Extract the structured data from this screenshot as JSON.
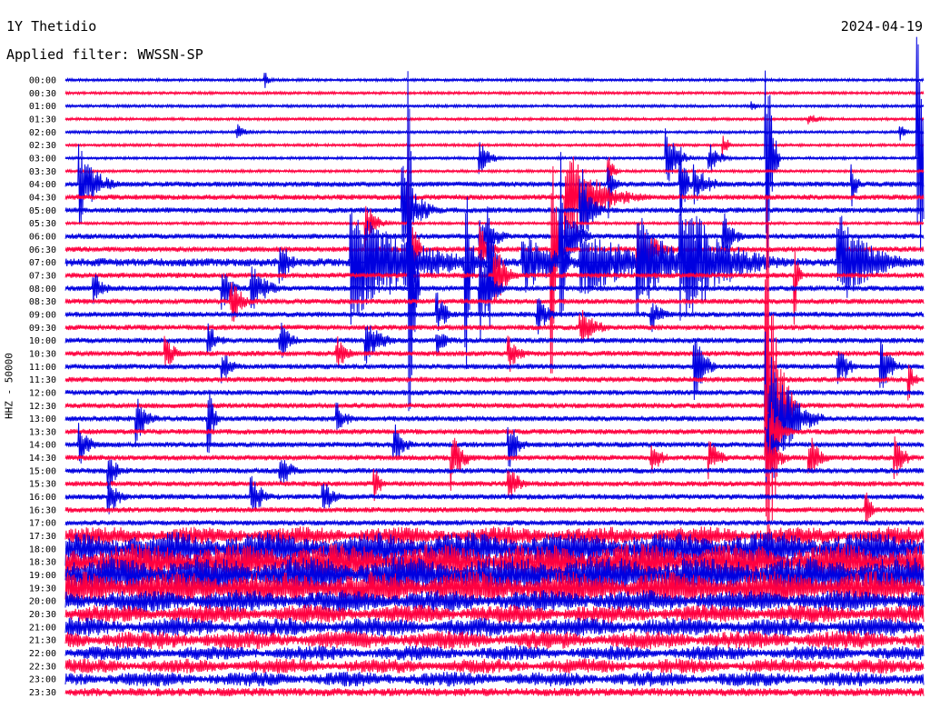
{
  "header": {
    "title": "1Y Thetidio",
    "date": "2024-04-19",
    "filter": "Applied filter: WWSSN-SP"
  },
  "chart_data": {
    "type": "helicorder",
    "title": "1Y Thetidio",
    "date": "2024-04-19",
    "filter": "WWSSN-SP",
    "ylabel": "HHZ - 50000",
    "trace_colors": [
      "#0000e0",
      "#ff0040"
    ],
    "row_labels": [
      "00:00",
      "00:30",
      "01:00",
      "01:30",
      "02:00",
      "02:30",
      "03:00",
      "03:30",
      "04:00",
      "04:30",
      "05:00",
      "05:30",
      "06:00",
      "06:30",
      "07:00",
      "07:30",
      "08:00",
      "08:30",
      "09:00",
      "09:30",
      "10:00",
      "10:30",
      "11:00",
      "11:30",
      "12:00",
      "12:30",
      "13:00",
      "13:30",
      "14:00",
      "14:30",
      "15:00",
      "15:30",
      "16:00",
      "16:30",
      "17:00",
      "17:30",
      "18:00",
      "18:30",
      "19:00",
      "19:30",
      "20:00",
      "20:30",
      "21:00",
      "21:30",
      "22:00",
      "22:30",
      "23:00",
      "23:30"
    ],
    "noise_level": [
      1,
      1,
      1,
      1,
      1,
      1,
      1,
      1,
      2,
      2,
      2,
      1,
      2,
      2,
      3,
      2,
      2,
      2,
      2,
      2,
      2,
      2,
      2,
      2,
      2,
      2,
      2,
      2,
      2,
      2,
      2,
      2,
      2,
      2,
      2,
      5,
      9,
      10,
      10,
      9,
      6,
      5,
      5,
      5,
      4,
      4,
      4,
      3
    ],
    "events": [
      {
        "row": 8,
        "minute": 0.5,
        "amplitude": 50,
        "duration": 1.5
      },
      {
        "row": 6,
        "minute": 22.5,
        "amplitude": 20,
        "duration": 1
      },
      {
        "row": 8,
        "minute": 22,
        "amplitude": 25,
        "duration": 1.5
      },
      {
        "row": 14,
        "minute": 10,
        "amplitude": 70,
        "duration": 6
      },
      {
        "row": 14,
        "minute": 16,
        "amplitude": 40,
        "duration": 3
      },
      {
        "row": 13,
        "minute": 12,
        "amplitude": 150,
        "duration": 0.5
      },
      {
        "row": 16,
        "minute": 12,
        "amplitude": 280,
        "duration": 0.4
      },
      {
        "row": 14,
        "minute": 18,
        "amplitude": 40,
        "duration": 6
      },
      {
        "row": 15,
        "minute": 25.5,
        "amplitude": 60,
        "duration": 0.3
      },
      {
        "row": 13,
        "minute": 17,
        "amplitude": 160,
        "duration": 0.4
      },
      {
        "row": 14,
        "minute": 21.5,
        "amplitude": 80,
        "duration": 4
      },
      {
        "row": 8,
        "minute": 19,
        "amplitude": 40,
        "duration": 0.5
      },
      {
        "row": 13,
        "minute": 20,
        "amplitude": 30,
        "duration": 2
      },
      {
        "row": 14,
        "minute": 27,
        "amplitude": 60,
        "duration": 3
      },
      {
        "row": 10,
        "minute": 18,
        "amplitude": 60,
        "duration": 1
      },
      {
        "row": 12,
        "minute": 17.5,
        "amplitude": 60,
        "duration": 1
      },
      {
        "row": 14,
        "minute": 17.3,
        "amplitude": 150,
        "duration": 0.3
      },
      {
        "row": 6,
        "minute": 21,
        "amplitude": 40,
        "duration": 1
      },
      {
        "row": 8,
        "minute": 21.5,
        "amplitude": 60,
        "duration": 0.5
      },
      {
        "row": 9,
        "minute": 17.5,
        "amplitude": 60,
        "duration": 3
      },
      {
        "row": 12,
        "minute": 23,
        "amplitude": 30,
        "duration": 1
      },
      {
        "row": 12,
        "minute": 14.5,
        "amplitude": 30,
        "duration": 1.5
      },
      {
        "row": 13,
        "minute": 14.5,
        "amplitude": 30,
        "duration": 1
      },
      {
        "row": 14,
        "minute": 14,
        "amplitude": 140,
        "duration": 0.4
      },
      {
        "row": 14,
        "minute": 14.8,
        "amplitude": 120,
        "duration": 0.4
      },
      {
        "row": 16,
        "minute": 14.5,
        "amplitude": 60,
        "duration": 1
      },
      {
        "row": 14,
        "minute": 20,
        "amplitude": 60,
        "duration": 3
      },
      {
        "row": 10,
        "minute": 11.8,
        "amplitude": 50,
        "duration": 1.5
      },
      {
        "row": 11,
        "minute": 10.5,
        "amplitude": 30,
        "duration": 1
      },
      {
        "row": 14,
        "minute": 7.5,
        "amplitude": 30,
        "duration": 1
      },
      {
        "row": 15,
        "minute": 15,
        "amplitude": 45,
        "duration": 1
      },
      {
        "row": 16,
        "minute": 1,
        "amplitude": 20,
        "duration": 1
      },
      {
        "row": 16,
        "minute": 5.5,
        "amplitude": 25,
        "duration": 1
      },
      {
        "row": 6,
        "minute": 14.5,
        "amplitude": 20,
        "duration": 1
      },
      {
        "row": 6,
        "minute": 24.5,
        "amplitude": 160,
        "duration": 0.5
      },
      {
        "row": 6,
        "minute": 29.8,
        "amplitude": 160,
        "duration": 0.8
      },
      {
        "row": 25,
        "minute": 24.5,
        "amplitude": 260,
        "duration": 1
      },
      {
        "row": 26,
        "minute": 24.5,
        "amplitude": 100,
        "duration": 2
      },
      {
        "row": 27,
        "minute": 24.5,
        "amplitude": 60,
        "duration": 1
      },
      {
        "row": 28,
        "minute": 24.5,
        "amplitude": 60,
        "duration": 0.5
      },
      {
        "row": 29,
        "minute": 24.5,
        "amplitude": 40,
        "duration": 1
      },
      {
        "row": 22,
        "minute": 22,
        "amplitude": 40,
        "duration": 1
      },
      {
        "row": 22,
        "minute": 27,
        "amplitude": 30,
        "duration": 1
      },
      {
        "row": 22,
        "minute": 28.5,
        "amplitude": 35,
        "duration": 1
      },
      {
        "row": 23,
        "minute": 29.5,
        "amplitude": 25,
        "duration": 0.5
      },
      {
        "row": 26,
        "minute": 5,
        "amplitude": 45,
        "duration": 0.5
      },
      {
        "row": 29,
        "minute": 29,
        "amplitude": 25,
        "duration": 1
      },
      {
        "row": 29,
        "minute": 26,
        "amplitude": 30,
        "duration": 1
      },
      {
        "row": 29,
        "minute": 22.5,
        "amplitude": 25,
        "duration": 1
      },
      {
        "row": 29,
        "minute": 20.5,
        "amplitude": 20,
        "duration": 1
      },
      {
        "row": 29,
        "minute": 13.5,
        "amplitude": 40,
        "duration": 1
      },
      {
        "row": 28,
        "minute": 15.5,
        "amplitude": 30,
        "duration": 1
      },
      {
        "row": 28,
        "minute": 0.5,
        "amplitude": 25,
        "duration": 1
      },
      {
        "row": 28,
        "minute": 11.5,
        "amplitude": 25,
        "duration": 1
      },
      {
        "row": 32,
        "minute": 1.5,
        "amplitude": 25,
        "duration": 1
      },
      {
        "row": 32,
        "minute": 6.5,
        "amplitude": 30,
        "duration": 1
      },
      {
        "row": 32,
        "minute": 9,
        "amplitude": 25,
        "duration": 1
      },
      {
        "row": 33,
        "minute": 28,
        "amplitude": 25,
        "duration": 0.5
      },
      {
        "row": 31,
        "minute": 15.5,
        "amplitude": 25,
        "duration": 1
      },
      {
        "row": 31,
        "minute": 10.8,
        "amplitude": 30,
        "duration": 0.5
      },
      {
        "row": 30,
        "minute": 7.5,
        "amplitude": 25,
        "duration": 1
      },
      {
        "row": 30,
        "minute": 1.5,
        "amplitude": 25,
        "duration": 1
      },
      {
        "row": 26,
        "minute": 2.5,
        "amplitude": 30,
        "duration": 1
      },
      {
        "row": 26,
        "minute": 9.5,
        "amplitude": 20,
        "duration": 1
      },
      {
        "row": 22,
        "minute": 5.5,
        "amplitude": 20,
        "duration": 1
      },
      {
        "row": 21,
        "minute": 3.5,
        "amplitude": 20,
        "duration": 1
      },
      {
        "row": 21,
        "minute": 9.5,
        "amplitude": 20,
        "duration": 1
      },
      {
        "row": 20,
        "minute": 5,
        "amplitude": 20,
        "duration": 1
      },
      {
        "row": 20,
        "minute": 7.5,
        "amplitude": 25,
        "duration": 1
      },
      {
        "row": 20,
        "minute": 13,
        "amplitude": 20,
        "duration": 1
      },
      {
        "row": 18,
        "minute": 13,
        "amplitude": 25,
        "duration": 1
      },
      {
        "row": 17,
        "minute": 5.8,
        "amplitude": 30,
        "duration": 1
      },
      {
        "row": 16,
        "minute": 6.5,
        "amplitude": 30,
        "duration": 1.5
      },
      {
        "row": 18,
        "minute": 16.5,
        "amplitude": 25,
        "duration": 1
      },
      {
        "row": 19,
        "minute": 18,
        "amplitude": 25,
        "duration": 1.5
      },
      {
        "row": 21,
        "minute": 15.5,
        "amplitude": 25,
        "duration": 1
      },
      {
        "row": 20,
        "minute": 10.5,
        "amplitude": 30,
        "duration": 1.5
      },
      {
        "row": 18,
        "minute": 20.5,
        "amplitude": 20,
        "duration": 1
      },
      {
        "row": 8,
        "minute": 27.5,
        "amplitude": 25,
        "duration": 0.5
      },
      {
        "row": 7,
        "minute": 19,
        "amplitude": 20,
        "duration": 0.5
      },
      {
        "row": 4,
        "minute": 6,
        "amplitude": 10,
        "duration": 1
      },
      {
        "row": 0,
        "minute": 7,
        "amplitude": 10,
        "duration": 0.5
      },
      {
        "row": 2,
        "minute": 24,
        "amplitude": 8,
        "duration": 0.5
      },
      {
        "row": 3,
        "minute": 26,
        "amplitude": 8,
        "duration": 1
      },
      {
        "row": 4,
        "minute": 29.2,
        "amplitude": 10,
        "duration": 0.5
      },
      {
        "row": 5,
        "minute": 23,
        "amplitude": 15,
        "duration": 0.5
      }
    ]
  }
}
